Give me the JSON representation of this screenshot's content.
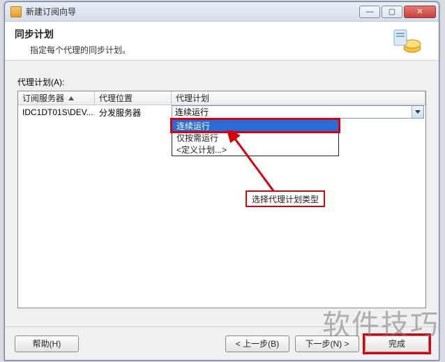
{
  "window": {
    "title": "新建订阅向导"
  },
  "header": {
    "title": "同步计划",
    "desc": "指定每个代理的同步计划。"
  },
  "grid": {
    "label": "代理计划(A):",
    "columns": {
      "subscriber": "订阅服务器",
      "agent_location": "代理位置",
      "agent_schedule": "代理计划"
    },
    "row": {
      "subscriber": "IDC1DT01S\\DEV...",
      "agent_location": "分发服务器",
      "agent_schedule_value": "连续运行"
    }
  },
  "dropdown": {
    "items": [
      "连续运行",
      "仅按需运行",
      "<定义计划...>"
    ],
    "selected_index": 0
  },
  "callout": {
    "text": "选择代理计划类型"
  },
  "footer": {
    "help": "帮助(H)",
    "back": "< 上一步(B)",
    "next": "下一步(N) >",
    "finish": "完成"
  },
  "watermark": "软件技巧",
  "colors": {
    "highlight_red": "#d8000c",
    "selection_blue": "#2a6bd6"
  }
}
